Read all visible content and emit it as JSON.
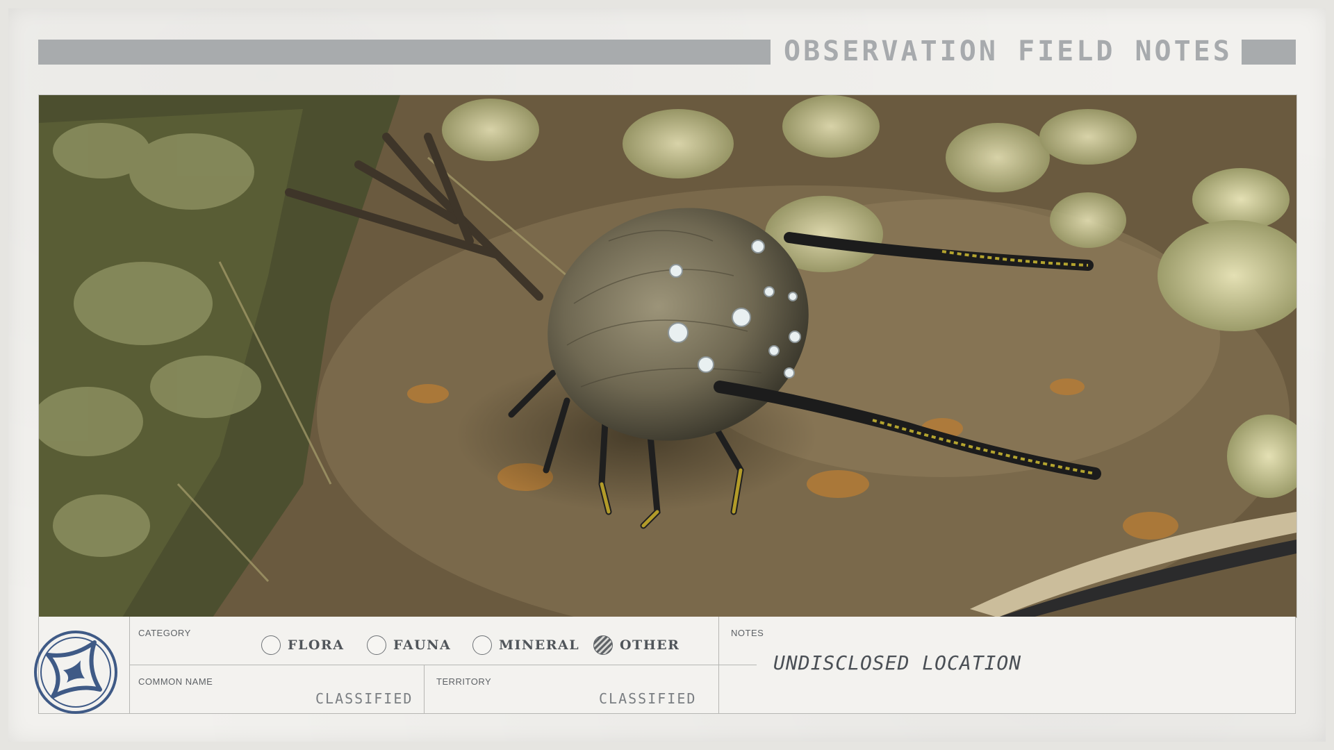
{
  "header": {
    "title": "OBSERVATION FIELD NOTES"
  },
  "photo": {
    "subject": "creature",
    "icon": "creature-photo"
  },
  "form": {
    "category": {
      "label": "CATEGORY",
      "options": [
        {
          "label": "FLORA",
          "selected": false
        },
        {
          "label": "FAUNA",
          "selected": false
        },
        {
          "label": "MINERAL",
          "selected": false
        },
        {
          "label": "OTHER",
          "selected": true
        }
      ]
    },
    "common_name": {
      "label": "COMMON NAME",
      "value": "CLASSIFIED"
    },
    "territory": {
      "label": "TERRITORY",
      "value": "CLASSIFIED"
    },
    "notes": {
      "label": "NOTES",
      "value": "UNDISCLOSED LOCATION"
    }
  },
  "colors": {
    "header_bar": "#a8abad",
    "ink": "#50555a",
    "emblem": "#3f5a86"
  }
}
